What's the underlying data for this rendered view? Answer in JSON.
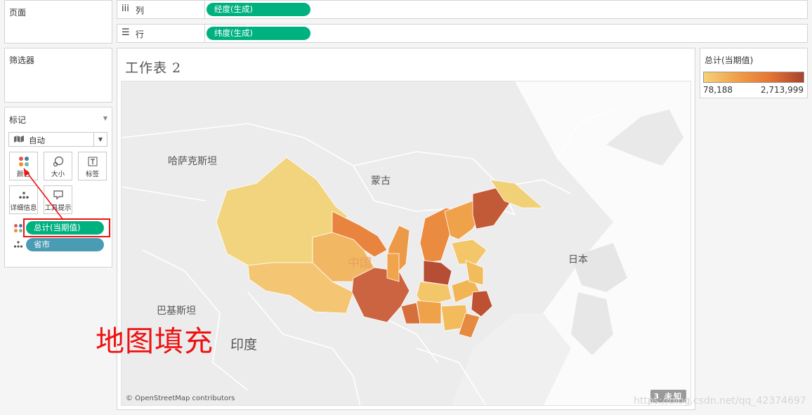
{
  "left": {
    "pages_title": "页面",
    "filters_title": "筛选器",
    "marks": {
      "title": "标记",
      "type_value": "自动",
      "buttons": [
        "颜色",
        "大小",
        "标签",
        "详细信息",
        "工具提示"
      ],
      "fields": [
        {
          "label": "总计(当期值)",
          "kind": "color"
        },
        {
          "label": "省市",
          "kind": "detail"
        }
      ]
    }
  },
  "shelves": {
    "columns": {
      "label": "列",
      "pill": "经度(生成)"
    },
    "rows": {
      "label": "行",
      "pill": "纬度(生成)"
    }
  },
  "sheet": {
    "title": "工作表 2",
    "map_labels": [
      "哈萨克斯坦",
      "蒙古",
      "中国",
      "日本",
      "巴基斯坦",
      "印度"
    ],
    "attribution": "© OpenStreetMap contributors",
    "unknown_badge": "3 未知"
  },
  "legend": {
    "title": "总计(当期值)",
    "min": "78,188",
    "max": "2,713,999",
    "colors": [
      "#f5d27a",
      "#f0a048",
      "#e57433",
      "#a8432e"
    ]
  },
  "annotation": "地图填充",
  "watermark": "https://blog.csdn.net/qq_42374697",
  "colors": {
    "pill_green": "#00b180",
    "pill_blue": "#4a9cb5",
    "annotation_red": "#ee1111"
  }
}
